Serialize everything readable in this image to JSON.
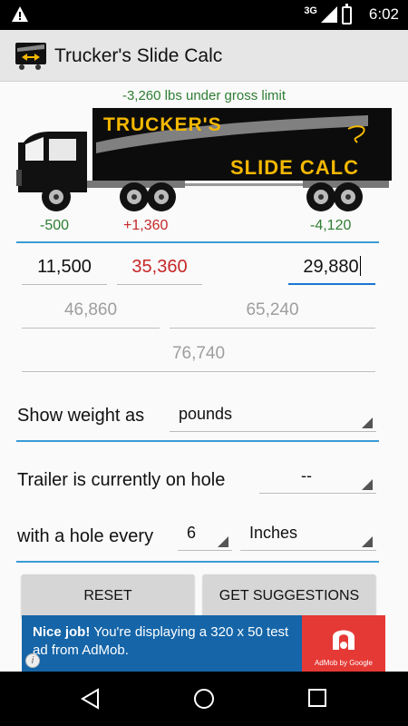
{
  "status_bar": {
    "network": "3G",
    "time": "6:02"
  },
  "app": {
    "title": "Trucker's Slide Calc"
  },
  "summary": {
    "under_gross": "-3,260 lbs under gross limit"
  },
  "logo": {
    "line1": "TRUCKER'S",
    "line2": "SLIDE CALC"
  },
  "axle_deltas": {
    "steer": "-500",
    "drive": "+1,360",
    "trailer": "-4,120"
  },
  "weights": {
    "steer": "11,500",
    "drive": "35,360",
    "trailer": "29,880",
    "steer_drive_total": "46,860",
    "drive_trailer_total": "65,240",
    "gross_total": "76,740"
  },
  "settings": {
    "show_weight_label": "Show weight as",
    "show_weight_value": "pounds",
    "trailer_hole_label": "Trailer is currently on hole",
    "trailer_hole_value": "--",
    "hole_every_label": "with a hole every",
    "hole_every_value": "6",
    "hole_unit_value": "Inches"
  },
  "buttons": {
    "reset": "RESET",
    "suggestions": "GET SUGGESTIONS"
  },
  "ad": {
    "headline": "Nice job!",
    "body": " You're displaying a 320 x 50 test ad from AdMob.",
    "brand": "AdMob by Google"
  },
  "colors": {
    "accent": "#3a9bd5",
    "positive": "#2e7d32",
    "negative": "#c62828",
    "logo_text": "#f5b800"
  }
}
